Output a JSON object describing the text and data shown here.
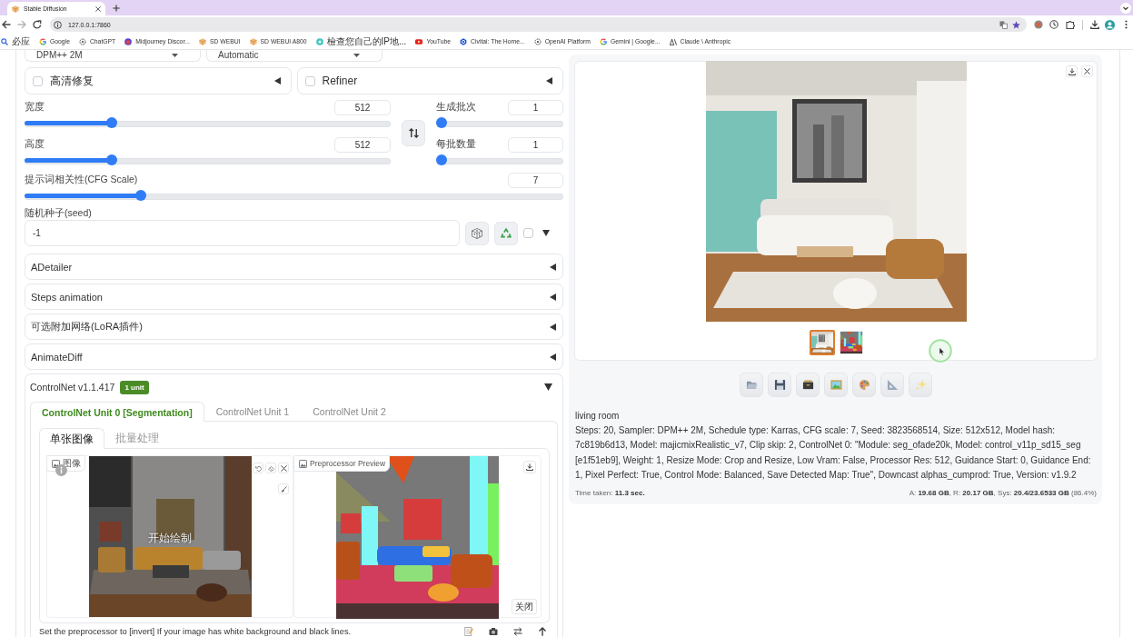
{
  "browser": {
    "tab_title": "Stable Diffusion",
    "url": "127.0.0.1:7860",
    "bookmarks": [
      {
        "label": "必应"
      },
      {
        "label": "Google"
      },
      {
        "label": "ChatGPT"
      },
      {
        "label": "Midjourney Discor..."
      },
      {
        "label": "SD WEBUI"
      },
      {
        "label": "SD WEBUI A800"
      },
      {
        "label": "檢查您自己的IP地..."
      },
      {
        "label": "YouTube"
      },
      {
        "label": "Civitai: The Home..."
      },
      {
        "label": "OpenAI Platform"
      },
      {
        "label": "Gemini | Google..."
      },
      {
        "label": "Claude \\ Anthropic"
      }
    ]
  },
  "sampler_fields": [
    {
      "value": "DPM++ 2M"
    },
    {
      "value": "Automatic"
    }
  ],
  "toggles": [
    {
      "label": "高清修复",
      "checked": false,
      "expanded": false
    },
    {
      "label": "Refiner",
      "checked": false,
      "expanded": false
    }
  ],
  "size_sliders": [
    {
      "label": "宽度",
      "value": "512",
      "level": 0.23
    },
    {
      "label": "高度",
      "value": "512",
      "level": 0.23
    }
  ],
  "batch_sliders": [
    {
      "label": "生成批次",
      "value": "1",
      "level": 0
    },
    {
      "label": "每批数量",
      "value": "1",
      "level": 0
    }
  ],
  "cfg_slider": {
    "label": "提示词相关性(CFG Scale)",
    "value": "7",
    "level": 0.21
  },
  "seed": {
    "label": "随机种子(seed)",
    "value": "-1",
    "extra_checked": false
  },
  "accordions": [
    {
      "label": "ADetailer",
      "expanded": false
    },
    {
      "label": "Steps animation",
      "expanded": false
    },
    {
      "label": "可选附加网络(LoRA插件)",
      "expanded": false
    },
    {
      "label": "AnimateDiff",
      "expanded": false
    }
  ],
  "controlnet": {
    "title": "ControlNet v1.1.417",
    "badge": "1 unit",
    "expanded": true,
    "unit_tabs": [
      {
        "label": "ControlNet Unit 0 [Segmentation]",
        "selected": true
      },
      {
        "label": "ControlNet Unit 1",
        "selected": false
      },
      {
        "label": "ControlNet Unit 2",
        "selected": false
      }
    ],
    "input_tabs": [
      {
        "label": "单张图像",
        "selected": true
      },
      {
        "label": "批量处理",
        "selected": false
      }
    ],
    "image_panel": {
      "label": "图像",
      "overlay": "开始绘制"
    },
    "preview_panel": {
      "label": "Preprocessor Preview",
      "close_button": "关闭"
    },
    "hint": "Set the preprocessor to [invert] If your image has white background and black lines."
  },
  "output": {
    "thumbnails": [
      {
        "kind": "render",
        "selected": true
      },
      {
        "kind": "segmentation",
        "selected": false
      }
    ],
    "prompt": "living room",
    "parameters": "Steps: 20, Sampler: DPM++ 2M, Schedule type: Karras, CFG scale: 7, Seed: 3823568514, Size: 512x512, Model hash: 7c819b6d13, Model: majicmixRealistic_v7, Clip skip: 2, ControlNet 0: \"Module: seg_ofade20k, Model: control_v11p_sd15_seg [e1f51eb9], Weight: 1, Resize Mode: Crop and Resize, Low Vram: False, Processor Res: 512, Guidance Start: 0, Guidance End: 1, Pixel Perfect: True, Control Mode: Balanced, Save Detected Map: True\", Downcast alphas_cumprod: True, Version: v1.9.2",
    "time_taken": "Time taken: **11.3 sec.**",
    "memory": "A: **19.68 GB**, R: **20.17 GB**, Sys: **20.4/23.6533 GB** (86.4%)"
  }
}
